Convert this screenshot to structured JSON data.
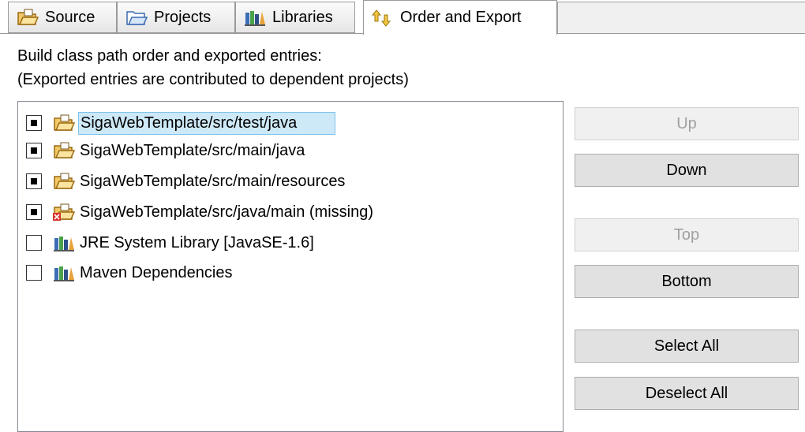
{
  "tabs": [
    {
      "label": "Source",
      "icon": "source-folder-icon"
    },
    {
      "label": "Projects",
      "icon": "projects-folder-icon"
    },
    {
      "label": "Libraries",
      "icon": "libraries-icon"
    },
    {
      "label": "Order and Export",
      "icon": "order-export-icon",
      "active": true
    }
  ],
  "description": {
    "line1": "Build class path order and exported entries:",
    "line2": "(Exported entries are contributed to dependent projects)"
  },
  "entries": [
    {
      "label": "SigaWebTemplate/src/test/java",
      "checked": true,
      "selected": true,
      "icon": "source-folder-icon"
    },
    {
      "label": "SigaWebTemplate/src/main/java",
      "checked": true,
      "icon": "source-folder-icon"
    },
    {
      "label": "SigaWebTemplate/src/main/resources",
      "checked": true,
      "icon": "source-folder-icon"
    },
    {
      "label": "SigaWebTemplate/src/java/main (missing)",
      "checked": true,
      "icon": "missing-source-folder-icon"
    },
    {
      "label": "JRE System Library [JavaSE-1.6]",
      "checked": false,
      "icon": "library-icon"
    },
    {
      "label": "Maven Dependencies",
      "checked": false,
      "icon": "library-icon"
    }
  ],
  "buttons": {
    "up": {
      "label": "Up",
      "enabled": false
    },
    "down": {
      "label": "Down",
      "enabled": true
    },
    "top": {
      "label": "Top",
      "enabled": false
    },
    "bottom": {
      "label": "Bottom",
      "enabled": true
    },
    "select_all": {
      "label": "Select All",
      "enabled": true
    },
    "deselect_all": {
      "label": "Deselect All",
      "enabled": true
    }
  },
  "colors": {
    "selection_bg": "#cde8f7",
    "selection_border": "#7ec3ea",
    "folder_fill": "#f3c868",
    "missing_marker": "#d9302c"
  }
}
